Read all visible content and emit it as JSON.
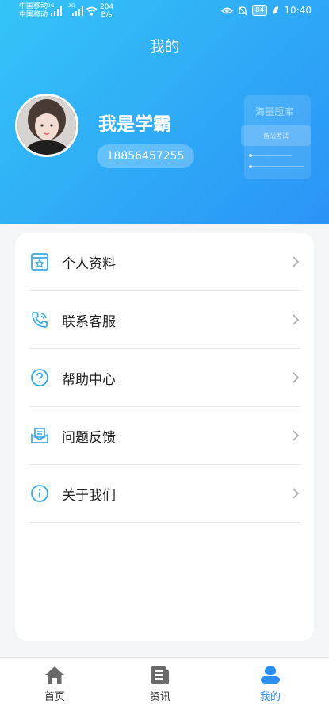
{
  "status_bar": {
    "carrier_1": "中国移动",
    "carrier_2": "中国移动",
    "net_badge_1": "2G",
    "net_badge_2": "2G",
    "speed_value": "204",
    "speed_unit": "B/s",
    "battery": "84",
    "time": "10:40"
  },
  "header": {
    "title": "我的",
    "username": "我是学霸",
    "phone": "18856457255",
    "decor_text_1": "海量题库",
    "decor_text_2": "备战考试"
  },
  "menu": {
    "items": [
      {
        "label": "个人资料",
        "icon": "profile-card-icon"
      },
      {
        "label": "联系客服",
        "icon": "phone-icon"
      },
      {
        "label": "帮助中心",
        "icon": "question-icon"
      },
      {
        "label": "问题反馈",
        "icon": "feedback-icon"
      },
      {
        "label": "关于我们",
        "icon": "info-icon"
      }
    ]
  },
  "tabbar": {
    "home": "首页",
    "news": "资讯",
    "mine": "我的"
  },
  "colors": {
    "header_start": "#35c4f7",
    "header_end": "#2a93f6",
    "icon_accent": "#3aa9e6",
    "active_tab": "#2a8ef2"
  }
}
